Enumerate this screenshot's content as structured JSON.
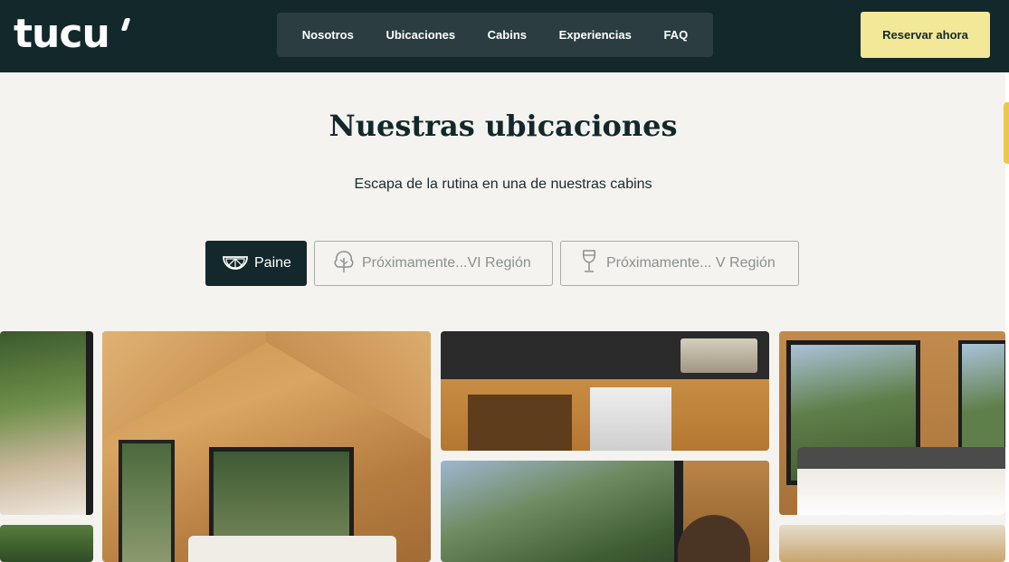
{
  "header": {
    "logo_text": "tucu",
    "nav": [
      {
        "label": "Nosotros"
      },
      {
        "label": "Ubicaciones"
      },
      {
        "label": "Cabins"
      },
      {
        "label": "Experiencias"
      },
      {
        "label": "FAQ"
      }
    ],
    "cta_label": "Reservar ahora"
  },
  "main": {
    "title": "Nuestras ubicaciones",
    "subtitle": "Escapa de la rutina en una de nuestras cabins",
    "tabs": [
      {
        "label": "Paine",
        "icon": "lemon-slice-icon",
        "active": true
      },
      {
        "label": "Próximamente...VI Región",
        "icon": "tree-icon",
        "active": false
      },
      {
        "label": "Próximamente... V Región",
        "icon": "wine-glass-icon",
        "active": false
      }
    ]
  },
  "gallery": {
    "photos": [
      {
        "subject": "cabin-bedroom-window"
      },
      {
        "subject": "forest"
      },
      {
        "subject": "cabin-interior-bed"
      },
      {
        "subject": "cabin-kitchen"
      },
      {
        "subject": "person-window-forest"
      },
      {
        "subject": "cabin-bed-window"
      },
      {
        "subject": "sunset-sky"
      }
    ]
  },
  "colors": {
    "header_bg": "#12282b",
    "nav_bg": "#2b3d40",
    "cta_bg": "#f2e897",
    "page_bg": "#f4f3ef",
    "accent_tab": "#e8c94b"
  }
}
